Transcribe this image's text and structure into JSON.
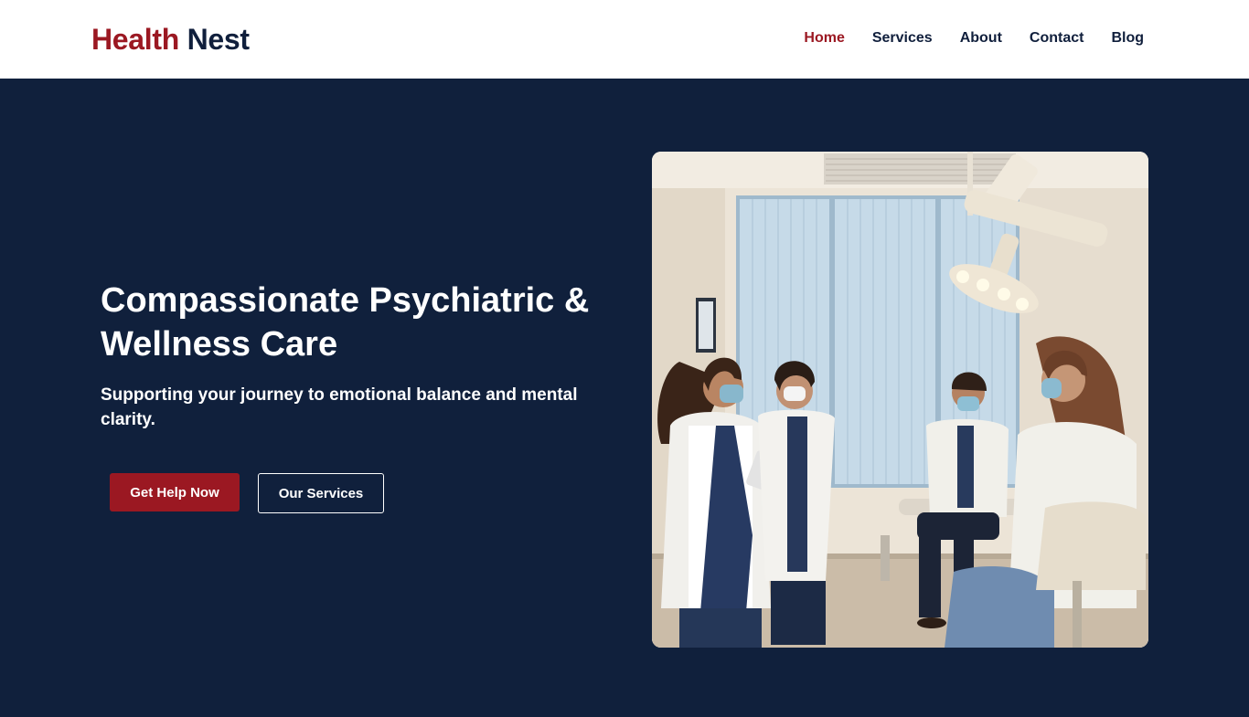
{
  "brand": {
    "part1": "Health",
    "part2": "Nest"
  },
  "nav": {
    "items": [
      {
        "label": "Home",
        "active": true
      },
      {
        "label": "Services",
        "active": false
      },
      {
        "label": "About",
        "active": false
      },
      {
        "label": "Contact",
        "active": false
      },
      {
        "label": "Blog",
        "active": false
      }
    ]
  },
  "hero": {
    "title": "Compassionate Psychiatric & Wellness Care",
    "subtitle": "Supporting your journey to emotional balance and mental clarity.",
    "primary_button": "Get Help Now",
    "secondary_button": "Our Services"
  },
  "colors": {
    "brand_red": "#9b1822",
    "navy": "#10203c",
    "white": "#ffffff"
  }
}
